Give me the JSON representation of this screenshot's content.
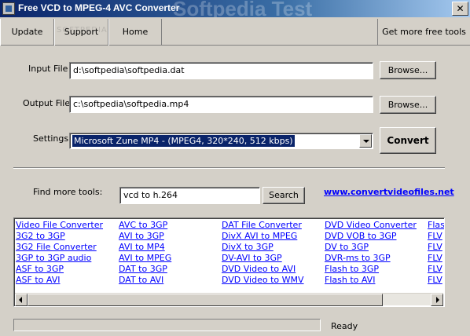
{
  "window": {
    "title": "Free VCD to MPEG-4 AVC Converter",
    "watermark": "Softpedia Test",
    "close_glyph": "✕"
  },
  "menu": {
    "update": "Update",
    "support": "Support",
    "home": "Home",
    "more_tools": "Get more free tools",
    "watermark": "SOFTPEDIA"
  },
  "input": {
    "label": "Input File",
    "value": "d:\\softpedia\\softpedia.dat",
    "browse": "Browse..."
  },
  "output": {
    "label": "Output File",
    "value": "c:\\softpedia\\softpedia.mp4",
    "browse": "Browse..."
  },
  "settings": {
    "label": "Settings",
    "selected": "Microsoft Zune MP4 - (MPEG4, 320*240, 512 kbps)"
  },
  "convert_label": "Convert",
  "find": {
    "label": "Find more tools:",
    "query": "vcd to h.264",
    "search": "Search",
    "website": "www.convertvideofiles.net"
  },
  "links": [
    [
      "Video File Converter",
      "3G2 to 3GP",
      "3G2 File Converter",
      "3GP to 3GP audio",
      "ASF to 3GP",
      "ASF to AVI"
    ],
    [
      "AVC to 3GP",
      "AVI to 3GP",
      "AVI to MP4",
      "AVI to MPEG",
      "DAT to 3GP",
      "DAT to AVI"
    ],
    [
      "DAT File Converter",
      "DivX AVI to MPEG",
      "DivX to 3GP",
      "DV-AVI to 3GP",
      "DVD Video to AVI",
      "DVD Video to WMV"
    ],
    [
      "DVD Video Converter",
      "DVD VOB to 3GP",
      "DV to 3GP",
      "DVR-ms to 3GP",
      "Flash to 3GP",
      "Flash to AVI"
    ],
    [
      "Flash",
      "FLV",
      "FLV",
      "FLV",
      "FLV",
      "FLV"
    ]
  ],
  "status": {
    "text": "Ready",
    "progress": 0
  }
}
